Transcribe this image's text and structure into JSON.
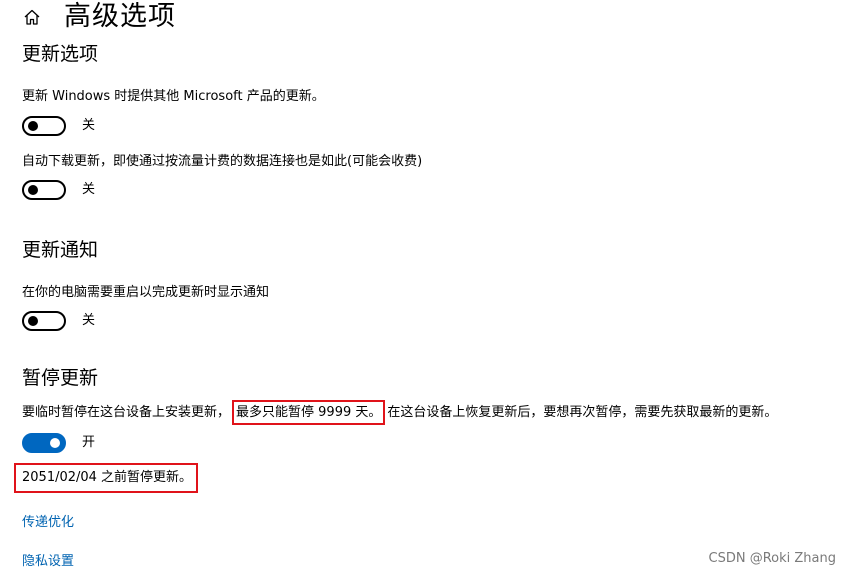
{
  "header": {
    "title": "高级选项",
    "home_icon": "home-icon"
  },
  "update_options": {
    "title": "更新选项",
    "items": [
      {
        "description": "更新 Windows 时提供其他 Microsoft 产品的更新。",
        "state_label": "关",
        "on": false
      },
      {
        "description": "自动下载更新，即使通过按流量计费的数据连接也是如此(可能会收费)",
        "state_label": "关",
        "on": false
      }
    ]
  },
  "update_notifications": {
    "title": "更新通知",
    "items": [
      {
        "description": "在你的电脑需要重启以完成更新时显示通知",
        "state_label": "关",
        "on": false
      }
    ]
  },
  "pause_updates": {
    "title": "暂停更新",
    "description_prefix": "要临时暂停在这台设备上安装更新，",
    "description_highlight": "最多只能暂停 9999 天。",
    "description_suffix": "在这台设备上恢复更新后，要想再次暂停，需要先获取最新的更新。",
    "state_label": "开",
    "on": true,
    "pause_until": "2051/02/04 之前暂停更新。"
  },
  "links": {
    "delivery_optimization": "传递优化",
    "privacy_settings": "隐私设置"
  },
  "watermark": "CSDN @Roki Zhang",
  "colors": {
    "accent": "#0067c0",
    "link": "#0063b1",
    "highlight_border": "#e0131a"
  }
}
